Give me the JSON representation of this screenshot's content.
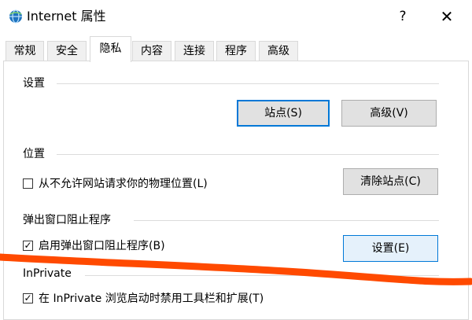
{
  "window": {
    "title": "Internet 属性",
    "help_glyph": "?",
    "close_glyph": "✕",
    "icon": "internet-explorer-globe-icon"
  },
  "tabs": [
    {
      "label": "常规",
      "active": false
    },
    {
      "label": "安全",
      "active": false
    },
    {
      "label": "隐私",
      "active": true
    },
    {
      "label": "内容",
      "active": false
    },
    {
      "label": "连接",
      "active": false
    },
    {
      "label": "程序",
      "active": false
    },
    {
      "label": "高级",
      "active": false
    }
  ],
  "settings": {
    "title": "设置",
    "sites_button": "站点(S)",
    "advanced_button": "高级(V)"
  },
  "location": {
    "title": "位置",
    "checkbox_label": "从不允许网站请求你的物理位置(L)",
    "checked": false,
    "clear_sites_button": "清除站点(C)"
  },
  "popup_blocker": {
    "title": "弹出窗口阻止程序",
    "checkbox_label": "启用弹出窗口阻止程序(B)",
    "checked": true,
    "settings_button": "设置(E)"
  },
  "inprivate": {
    "title": "InPrivate",
    "checkbox_label": "在 InPrivate 浏览启动时禁用工具栏和扩展(T)",
    "checked": true
  },
  "check_glyph": "✓",
  "colors": {
    "annotation_stroke": "#ff4a00",
    "focus_border": "#0078d7"
  }
}
